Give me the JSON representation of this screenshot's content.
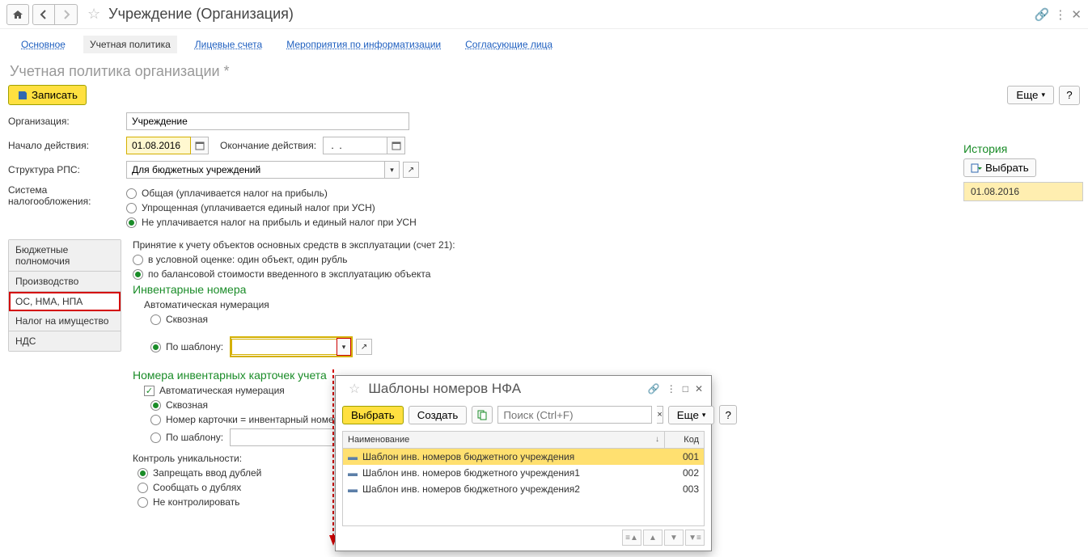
{
  "titlebar": {
    "title": "Учреждение (Организация)"
  },
  "tabs": {
    "main": "Основное",
    "policy": "Учетная политика",
    "accounts": "Лицевые счета",
    "events": "Мероприятия по информатизации",
    "approvers": "Согласующие лица"
  },
  "section": {
    "title": "Учетная политика организации *"
  },
  "cmd": {
    "save": "Записать",
    "more": "Еще"
  },
  "form": {
    "org_label": "Организация:",
    "org_value": "Учреждение",
    "start_label": "Начало действия:",
    "start_value": "01.08.2016",
    "end_label": "Окончание действия:",
    "end_value": " .  . ",
    "rps_label": "Структура РПС:",
    "rps_value": "Для бюджетных учреждений",
    "tax_label": "Система налогообложения:",
    "tax_options": {
      "general": "Общая (уплачивается налог на прибыль)",
      "simplified": "Упрощенная (уплачивается единый налог при УСН)",
      "none": "Не уплачивается налог на прибыль и единый налог при УСН"
    }
  },
  "leftnav": {
    "budget": "Бюджетные полномочия",
    "production": "Производство",
    "os": "ОС, НМА, НПА",
    "property": "Налог на имущество",
    "vat": "НДС"
  },
  "os_section": {
    "heading": "Принятие к учету объектов основных средств в эксплуатации (счет 21):",
    "opt1": "в условной оценке: один объект, один рубль",
    "opt2": "по балансовой стоимости введенного в эксплуатацию объекта",
    "inv_title": "Инвентарные номера",
    "auto_num": "Автоматическая нумерация",
    "through": "Сквозная",
    "by_template": "По шаблону:",
    "cards_title": "Номера инвентарных карточек учета",
    "cards_auto": "Автоматическая нумерация",
    "cards_through": "Сквозная",
    "cards_eq": "Номер карточки = инвентарный номер",
    "cards_tmpl": "По шаблону:",
    "control": "Контроль уникальности:",
    "ctrl1": "Запрещать ввод дублей",
    "ctrl2": "Сообщать о дублях",
    "ctrl3": "Не контролировать"
  },
  "history": {
    "title": "История",
    "select": "Выбрать",
    "items": [
      "01.08.2016"
    ]
  },
  "popup": {
    "title": "Шаблоны номеров НФА",
    "select": "Выбрать",
    "create": "Создать",
    "search_ph": "Поиск (Ctrl+F)",
    "more": "Еще",
    "col_name": "Наименование",
    "col_code": "Код",
    "rows": [
      {
        "name": "Шаблон инв. номеров бюджетного учреждения",
        "code": "001"
      },
      {
        "name": "Шаблон инв. номеров бюджетного учреждения1",
        "code": "002"
      },
      {
        "name": "Шаблон инв. номеров бюджетного учреждения2",
        "code": "003"
      }
    ]
  }
}
